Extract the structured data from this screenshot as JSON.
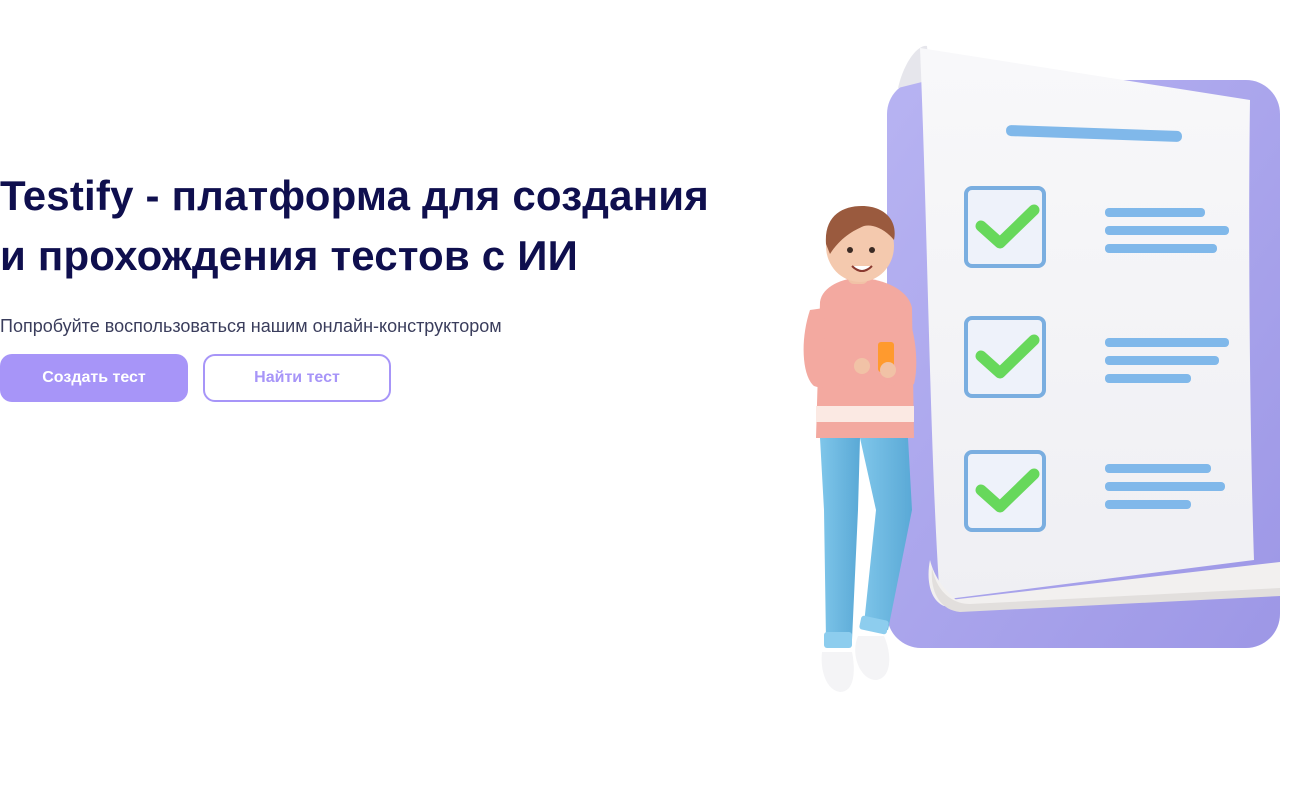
{
  "hero": {
    "title": "Testify - платформа для создания и прохождения тестов с ИИ",
    "subtitle": "Попробуйте воспользоваться нашим онлайн-конструктором",
    "primary_button": "Создать тест",
    "secondary_button": "Найти тест"
  },
  "illustration": {
    "checklist_items": 3,
    "icon": "checklist-illustration-icon"
  },
  "colors": {
    "title": "#0f0f4e",
    "accent": "#a795f8",
    "panel": "#a8a4ec",
    "check": "#66d95a",
    "line": "#7fb6ea"
  }
}
